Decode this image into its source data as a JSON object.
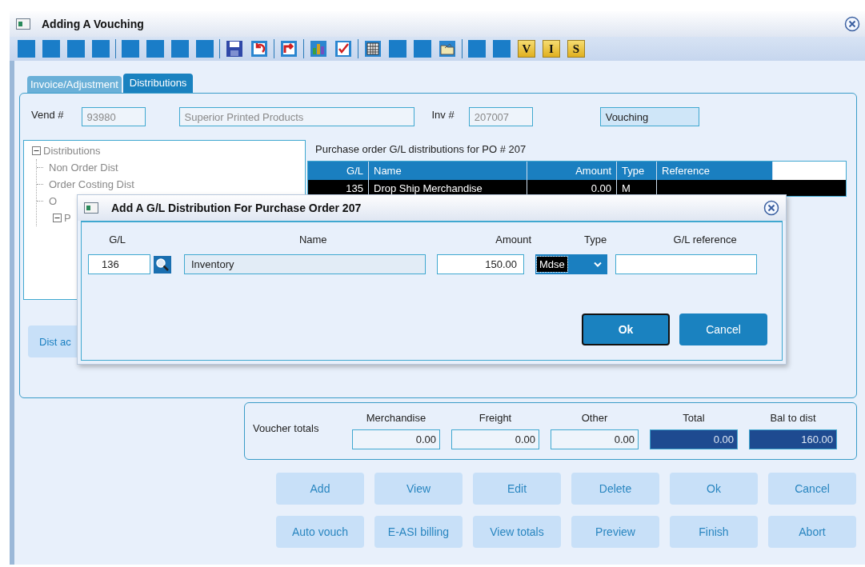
{
  "window": {
    "title": "Adding A Vouching"
  },
  "toolbar": [
    {
      "kind": "blank"
    },
    {
      "kind": "blank"
    },
    {
      "kind": "blank"
    },
    {
      "kind": "blank"
    },
    {
      "kind": "separator"
    },
    {
      "kind": "blank"
    },
    {
      "kind": "blank"
    },
    {
      "kind": "blank"
    },
    {
      "kind": "blank"
    },
    {
      "kind": "separator"
    },
    {
      "kind": "save"
    },
    {
      "kind": "undo"
    },
    {
      "kind": "separator"
    },
    {
      "kind": "redo"
    },
    {
      "kind": "separator"
    },
    {
      "kind": "chart"
    },
    {
      "kind": "check"
    },
    {
      "kind": "separator"
    },
    {
      "kind": "table"
    },
    {
      "kind": "blank"
    },
    {
      "kind": "blank"
    },
    {
      "kind": "folder"
    },
    {
      "kind": "separator"
    },
    {
      "kind": "blank"
    },
    {
      "kind": "blank"
    },
    {
      "kind": "letter",
      "label": "V"
    },
    {
      "kind": "letter",
      "label": "I"
    },
    {
      "kind": "letter",
      "label": "S"
    }
  ],
  "tabs": [
    {
      "label": "Invoice/Adjustment",
      "selected": false
    },
    {
      "label": "Distributions",
      "selected": true
    }
  ],
  "header": {
    "vend_label": "Vend #",
    "vend_number": {
      "value": "93980",
      "disabled": true
    },
    "vendor_name": {
      "value": "Superior Printed Products",
      "disabled": true
    },
    "inv_label": "Inv #",
    "inv_number": {
      "value": "207007",
      "disabled": true
    },
    "status": {
      "value": "Vouching",
      "disabled": false
    }
  },
  "tree": [
    {
      "label": "Distributions",
      "expanded": true,
      "children": [
        {
          "label": "Non Order Dist"
        },
        {
          "label": "Order Costing Dist"
        },
        {
          "label": "O"
        },
        {
          "label": "P",
          "expanded": true
        }
      ]
    }
  ],
  "grid": {
    "caption": "Purchase order G/L distributions for PO # 207",
    "columns": [
      "G/L",
      "Name",
      "Amount",
      "Type",
      "Reference"
    ],
    "rows": [
      {
        "gl": "135",
        "name": "Drop Ship Merchandise",
        "amount": "0.00",
        "type": "M",
        "selected": true
      }
    ]
  },
  "dist_button": "Dist ac",
  "totals": {
    "label": "Voucher totals",
    "columns": [
      {
        "label": "Merchandise",
        "value": "0.00",
        "highlighted": false
      },
      {
        "label": "Freight",
        "value": "0.00",
        "highlighted": false
      },
      {
        "label": "Other",
        "value": "0.00",
        "highlighted": false
      },
      {
        "label": "Total",
        "value": "0.00",
        "highlighted": true
      },
      {
        "label": "Bal to dist",
        "value": "160.00",
        "highlighted": true
      }
    ]
  },
  "buttons": [
    [
      "Add",
      "View",
      "Edit",
      "Delete",
      "Ok",
      "Cancel"
    ],
    [
      "Auto vouch",
      "E-ASI billing",
      "View totals",
      "Preview",
      "Finish",
      "Abort"
    ]
  ],
  "dialog": {
    "title": "Add A G/L Distribution For Purchase Order 207",
    "labels": [
      "G/L",
      "Name",
      "Amount",
      "Type",
      "G/L reference"
    ],
    "gl": "136",
    "name": "Inventory",
    "amount": "150.00",
    "type": "Mdse",
    "ok": "Ok",
    "cancel": "Cancel"
  }
}
